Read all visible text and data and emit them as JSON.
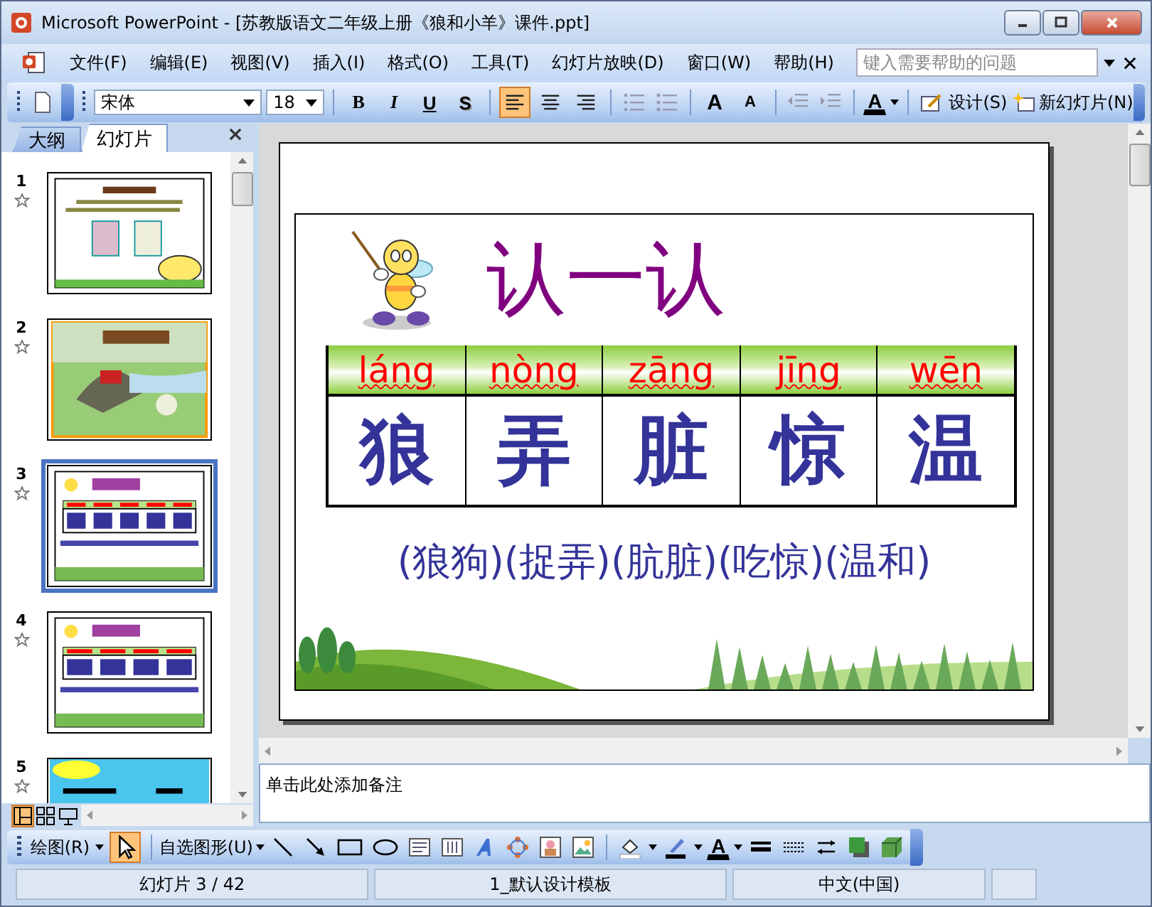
{
  "window": {
    "title": "Microsoft PowerPoint - [苏教版语文二年级上册《狼和小羊》课件.ppt]"
  },
  "menu": [
    "文件(F)",
    "编辑(E)",
    "视图(V)",
    "插入(I)",
    "格式(O)",
    "工具(T)",
    "幻灯片放映(D)",
    "窗口(W)",
    "帮助(H)"
  ],
  "help_search": {
    "placeholder": "键入需要帮助的问题"
  },
  "formatting_toolbar": {
    "font": "宋体",
    "size": "18",
    "text_buttons": [
      {
        "kind": "bold",
        "label": "B"
      },
      {
        "kind": "italic",
        "label": "I"
      },
      {
        "kind": "underline",
        "label": "U"
      },
      {
        "kind": "shadow",
        "label": "S"
      }
    ],
    "alignment": [
      {
        "kind": "left",
        "selected": true
      },
      {
        "kind": "center",
        "selected": false
      },
      {
        "kind": "right",
        "selected": false
      }
    ],
    "size_buttons": [
      {
        "kind": "grow",
        "label": "A"
      },
      {
        "kind": "shrink",
        "label": "A"
      }
    ],
    "font_color": "A",
    "design": "设计(S)",
    "new_slide": "新幻灯片(N)"
  },
  "panel_tabs": [
    {
      "label": "大纲",
      "selected": false
    },
    {
      "label": "幻灯片",
      "selected": true
    }
  ],
  "slides": [
    {
      "number": "1",
      "kind": "intro",
      "selected": false
    },
    {
      "number": "2",
      "kind": "cover",
      "selected": false
    },
    {
      "number": "3",
      "kind": "table5",
      "selected": true
    },
    {
      "number": "4",
      "kind": "table4",
      "selected": false
    },
    {
      "number": "5",
      "kind": "banner",
      "selected": false
    }
  ],
  "slide": {
    "title": "认一认",
    "characters": [
      {
        "pinyin": "láng",
        "hanzi": "狼"
      },
      {
        "pinyin": "nòng",
        "hanzi": "弄"
      },
      {
        "pinyin": "zāng",
        "hanzi": "脏"
      },
      {
        "pinyin": "jīng",
        "hanzi": "惊"
      },
      {
        "pinyin": "wēn",
        "hanzi": "温"
      }
    ],
    "phrases": "(狼狗)(捉弄)(肮脏)(吃惊)(温和)"
  },
  "notes": {
    "placeholder": "单击此处添加备注"
  },
  "drawing_toolbar": {
    "draw": "绘图(R)",
    "autoshapes": "自选图形(U)",
    "font_color": "A"
  },
  "status_bar": [
    "幻灯片 3 / 42",
    "1_默认设计模板",
    "中文(中国)"
  ]
}
